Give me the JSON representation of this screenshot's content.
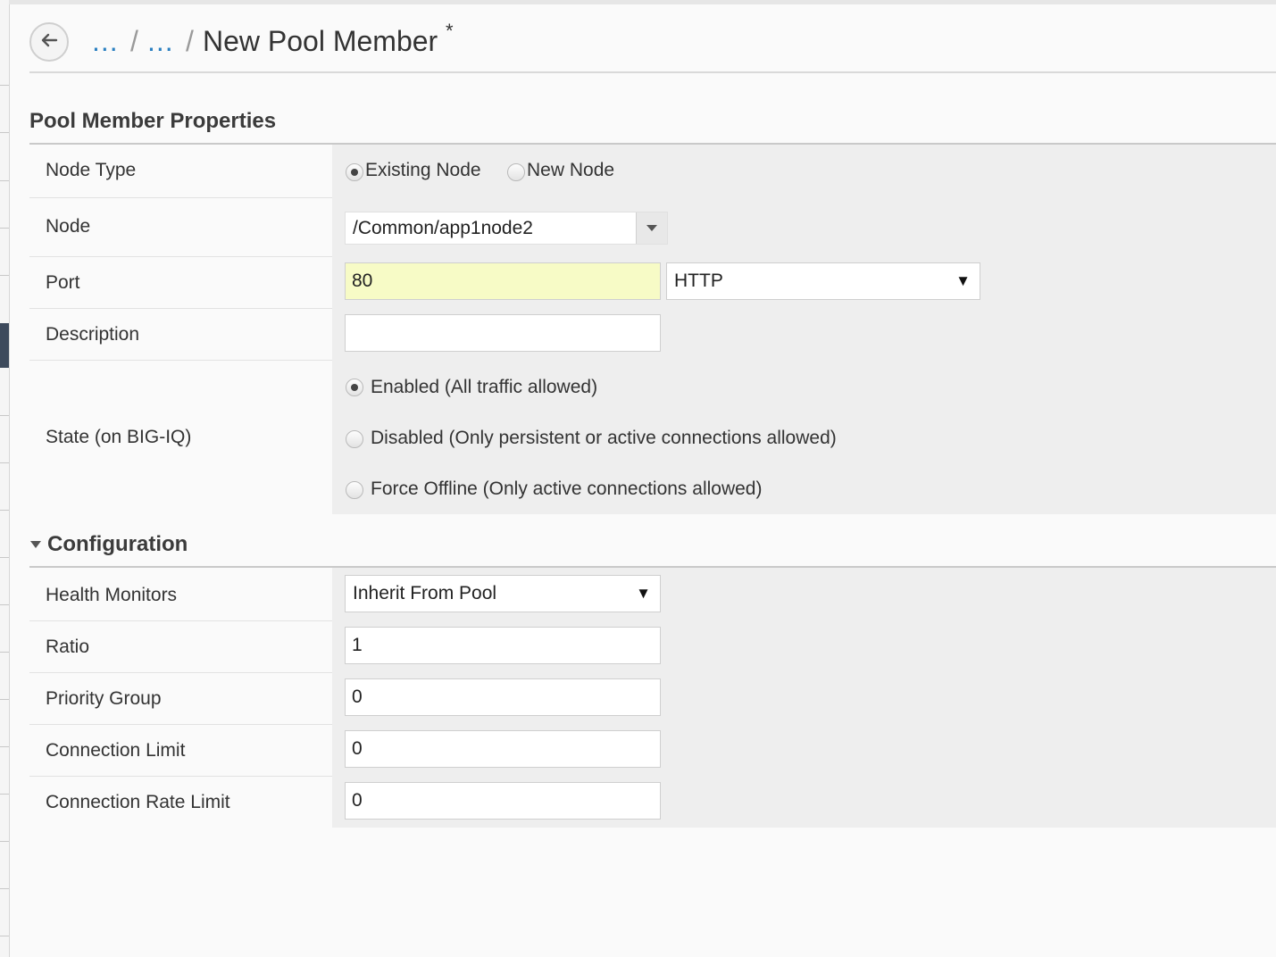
{
  "breadcrumb": {
    "crumb1": "...",
    "crumb2": "...",
    "separator": "/",
    "title": "New Pool Member",
    "unsaved_marker": "*"
  },
  "sections": {
    "properties": {
      "title": "Pool Member Properties"
    },
    "configuration": {
      "title": "Configuration"
    }
  },
  "node_type": {
    "label": "Node Type",
    "options": [
      "Existing Node",
      "New Node"
    ],
    "selected": "Existing Node"
  },
  "node": {
    "label": "Node",
    "value": "/Common/app1node2"
  },
  "port": {
    "label": "Port",
    "value": "80",
    "service": "HTTP"
  },
  "description": {
    "label": "Description",
    "value": ""
  },
  "state": {
    "label": "State (on BIG-IQ)",
    "options": [
      "Enabled (All traffic allowed)",
      "Disabled (Only persistent or active connections allowed)",
      "Force Offline (Only active connections allowed)"
    ],
    "selected": "Enabled (All traffic allowed)"
  },
  "health_monitors": {
    "label": "Health Monitors",
    "value": "Inherit From Pool"
  },
  "ratio": {
    "label": "Ratio",
    "value": "1"
  },
  "priority_group": {
    "label": "Priority Group",
    "value": "0"
  },
  "connection_limit": {
    "label": "Connection Limit",
    "value": "0"
  },
  "connection_rate_limit": {
    "label": "Connection Rate Limit",
    "value": "0"
  },
  "icons": {
    "back": "back-arrow-icon",
    "dropdown": "caret-down-icon",
    "collapse": "collapse-triangle-icon"
  },
  "colors": {
    "link": "#2a7fc1",
    "port_highlight": "#f7fbc6",
    "value_bg": "#eeeeee"
  }
}
